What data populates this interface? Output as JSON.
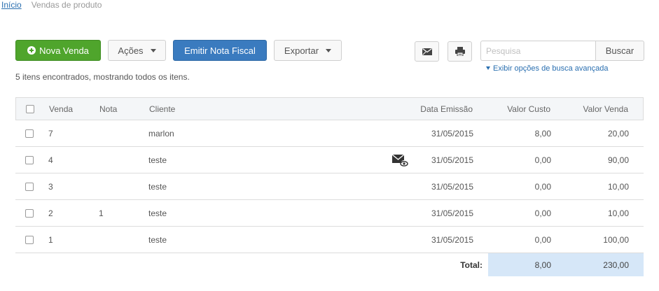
{
  "breadcrumb": {
    "home": "Início",
    "current": "Vendas de produto"
  },
  "toolbar": {
    "new_sale": "Nova Venda",
    "actions": "Ações",
    "emit_invoice": "Emitir Nota Fiscal",
    "export": "Exportar"
  },
  "search": {
    "placeholder": "Pesquisa",
    "button": "Buscar",
    "advanced_link": "Exibir opções de busca avançada"
  },
  "result_count": "5 itens encontrados, mostrando todos os itens.",
  "table": {
    "headers": {
      "venda": "Venda",
      "nota": "Nota",
      "cliente": "Cliente",
      "data": "Data Emissão",
      "custo": "Valor Custo",
      "valor": "Valor Venda"
    },
    "rows": [
      {
        "venda": "7",
        "nota": "",
        "cliente": "marlon",
        "data": "31/05/2015",
        "custo": "8,00",
        "valor": "20,00",
        "icons": false
      },
      {
        "venda": "4",
        "nota": "",
        "cliente": "teste",
        "data": "31/05/2015",
        "custo": "0,00",
        "valor": "90,00",
        "icons": true
      },
      {
        "venda": "3",
        "nota": "",
        "cliente": "teste",
        "data": "31/05/2015",
        "custo": "0,00",
        "valor": "10,00",
        "icons": false
      },
      {
        "venda": "2",
        "nota": "1",
        "cliente": "teste",
        "data": "31/05/2015",
        "custo": "0,00",
        "valor": "10,00",
        "icons": false
      },
      {
        "venda": "1",
        "nota": "",
        "cliente": "teste",
        "data": "31/05/2015",
        "custo": "0,00",
        "valor": "100,00",
        "icons": false
      }
    ],
    "total": {
      "label": "Total:",
      "custo": "8,00",
      "valor": "230,00"
    }
  },
  "icons": {
    "email": "envelope-icon",
    "print": "printer-icon",
    "email_view": "envelope-eye-icon"
  },
  "colors": {
    "primary_green": "#4fa52c",
    "primary_blue": "#3a7bbf",
    "link": "#2a6fb0",
    "total_bg": "#d6e7f8"
  }
}
